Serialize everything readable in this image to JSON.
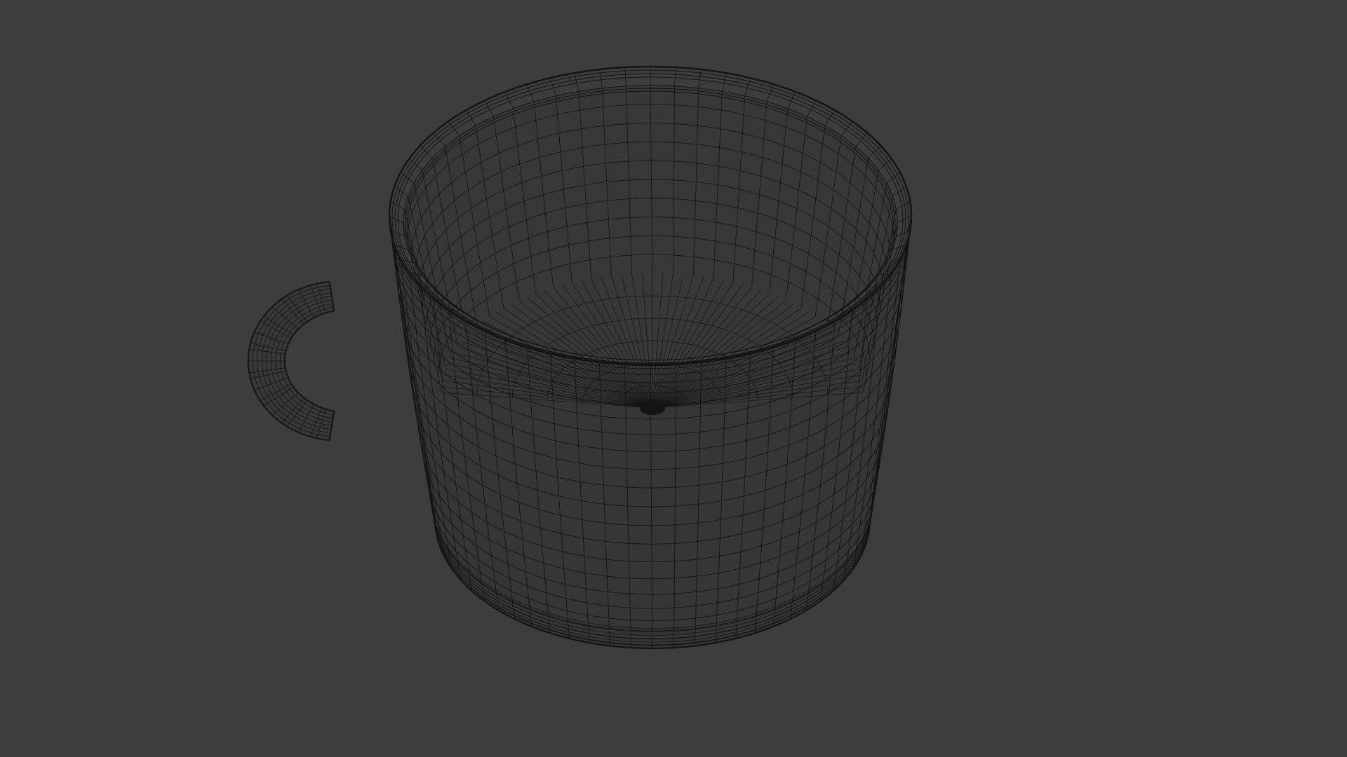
{
  "viewport": {
    "background_color": "#3d3d3d",
    "wire_color": "#141414",
    "view_mode": "wireframe"
  },
  "object": {
    "type": "cup",
    "rim_segments": 64,
    "body_rings": 22,
    "interior_rings": 9,
    "handle_segments": 24
  }
}
